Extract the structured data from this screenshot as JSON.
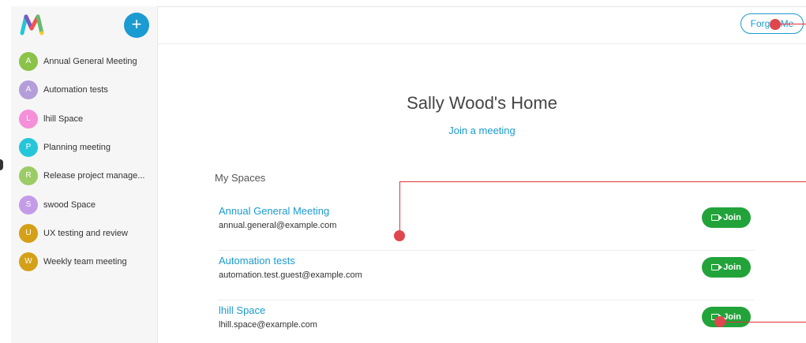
{
  "sidebar": {
    "add_label": "+",
    "items": [
      {
        "initial": "A",
        "label": "Annual General Meeting",
        "color": "#8bc34a"
      },
      {
        "initial": "A",
        "label": "Automation tests",
        "color": "#b39ddb"
      },
      {
        "initial": "L",
        "label": "lhill Space",
        "color": "#f48fd8"
      },
      {
        "initial": "P",
        "label": "Planning meeting",
        "color": "#26c6da"
      },
      {
        "initial": "R",
        "label": "Release project manage...",
        "color": "#9ccc65"
      },
      {
        "initial": "S",
        "label": "swood Space",
        "color": "#c39ce8"
      },
      {
        "initial": "U",
        "label": "UX testing and review",
        "color": "#d4a017"
      },
      {
        "initial": "W",
        "label": "Weekly team meeting",
        "color": "#d4a017"
      }
    ]
  },
  "header": {
    "forget_label": "Forget Me"
  },
  "main": {
    "title": "Sally Wood's Home",
    "join_link": "Join a meeting",
    "section_label": "My Spaces",
    "join_label": "Join",
    "spaces": [
      {
        "title": "Annual General Meeting",
        "email": "annual.general@example.com"
      },
      {
        "title": "Automation tests",
        "email": "automation.test.guest@example.com"
      },
      {
        "title": "lhill Space",
        "email": "lhill.space@example.com"
      }
    ]
  },
  "colors": {
    "accent": "#1a9bd1",
    "join_green": "#22a33a",
    "annotation_red": "#e0313a"
  }
}
